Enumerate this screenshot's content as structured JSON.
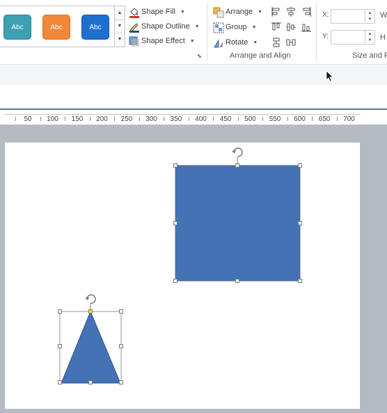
{
  "shape_styles": {
    "buttons": [
      {
        "label": "Abc",
        "color": "#3c9fb2"
      },
      {
        "label": "Abc",
        "color": "#f0873a"
      },
      {
        "label": "Abc",
        "color": "#1e6fcf"
      }
    ],
    "shape_fill": "Shape Fill",
    "shape_outline": "Shape Outline",
    "shape_effect": "Shape Effect"
  },
  "arrange_align": {
    "arrange": "Arrange",
    "group": "Group",
    "rotate": "Rotate",
    "label": "Arrange and Align"
  },
  "size_position": {
    "x_label": "X:",
    "y_label": "Y:",
    "w_label": "W",
    "h_label": "H",
    "x_value": "",
    "y_value": "",
    "label": "Size and P"
  },
  "ruler": {
    "ticks": [
      "50",
      "100",
      "150",
      "200",
      "250",
      "300",
      "350",
      "400",
      "450",
      "500",
      "550",
      "600",
      "650",
      "700"
    ]
  },
  "shapes": {
    "rectangle_color": "#4472b4",
    "triangle_color": "#4472b4",
    "adjust_handle_color": "#f5e00c"
  }
}
